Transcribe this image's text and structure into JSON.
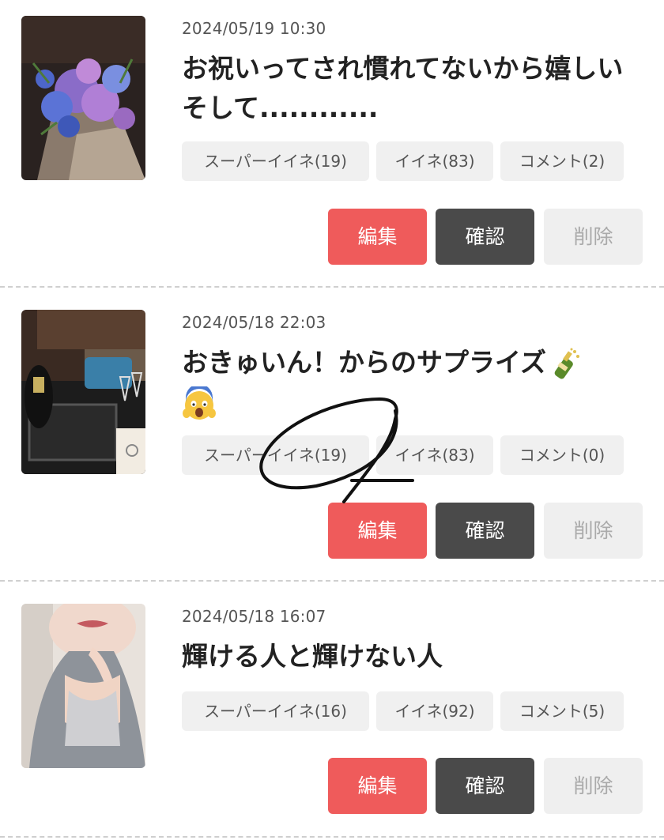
{
  "posts": [
    {
      "date": "2024/05/19 10:30",
      "title": "お祝いってされ慣れてないから嬉しい そして............",
      "stats": {
        "super_like": "スーパーイイネ(19)",
        "like": "イイネ(83)",
        "comment": "コメント(2)"
      },
      "thumbnail_icon": "bouquet-photo"
    },
    {
      "date": "2024/05/18 22:03",
      "title": "おきゅいん！からのサプライズ",
      "title_emoji": [
        "champagne-emoji",
        "screaming-face-emoji"
      ],
      "stats": {
        "super_like": "スーパーイイネ(19)",
        "like": "イイネ(83)",
        "comment": "コメント(0)"
      },
      "thumbnail_icon": "champagne-bar-photo"
    },
    {
      "date": "2024/05/18 16:07",
      "title": "輝ける人と輝けない人",
      "stats": {
        "super_like": "スーパーイイネ(16)",
        "like": "イイネ(92)",
        "comment": "コメント(5)"
      },
      "thumbnail_icon": "portrait-photo"
    }
  ],
  "actions": {
    "edit": "編集",
    "confirm": "確認",
    "delete": "削除"
  },
  "colors": {
    "edit_button": "#ef5b5b",
    "confirm_button": "#4a4a4a",
    "delete_button": "#efefef",
    "stat_background": "#f0f0f0"
  }
}
